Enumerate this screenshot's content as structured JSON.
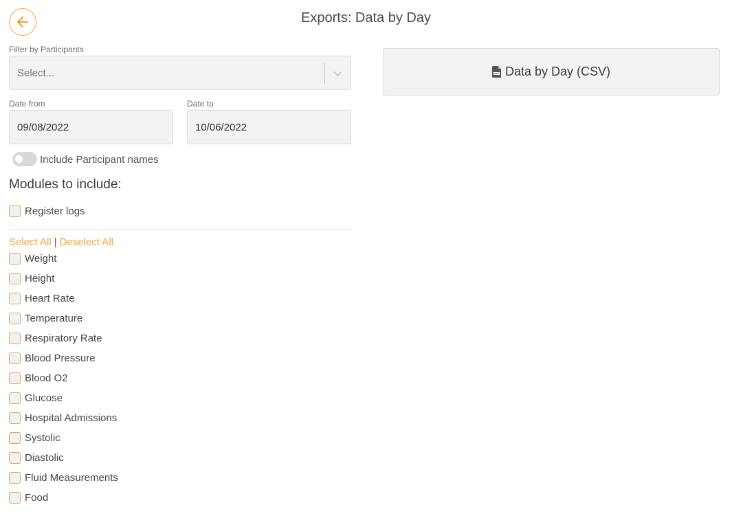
{
  "header": {
    "title": "Exports: Data by Day",
    "back_icon": "arrow-left-icon",
    "accent_color": "#f2a33a"
  },
  "filter": {
    "label": "Filter by Participants",
    "placeholder": "Select..."
  },
  "dates": {
    "from_label": "Date from",
    "from_value": "09/08/2022",
    "to_label": "Date to",
    "to_value": "10/06/2022"
  },
  "toggle": {
    "label": "Include Participant names",
    "on": false
  },
  "modules": {
    "heading": "Modules to include:",
    "register_logs": "Register logs",
    "select_all": "Select All",
    "separator": "|",
    "deselect_all": "Deselect All",
    "items": [
      "Weight",
      "Height",
      "Heart Rate",
      "Temperature",
      "Respiratory Rate",
      "Blood Pressure",
      "Blood O2",
      "Glucose",
      "Hospital Admissions",
      "Systolic",
      "Diastolic",
      "Fluid Measurements",
      "Food"
    ]
  },
  "export": {
    "button_label": "Data by Day (CSV)",
    "icon": "csv-file-icon"
  }
}
